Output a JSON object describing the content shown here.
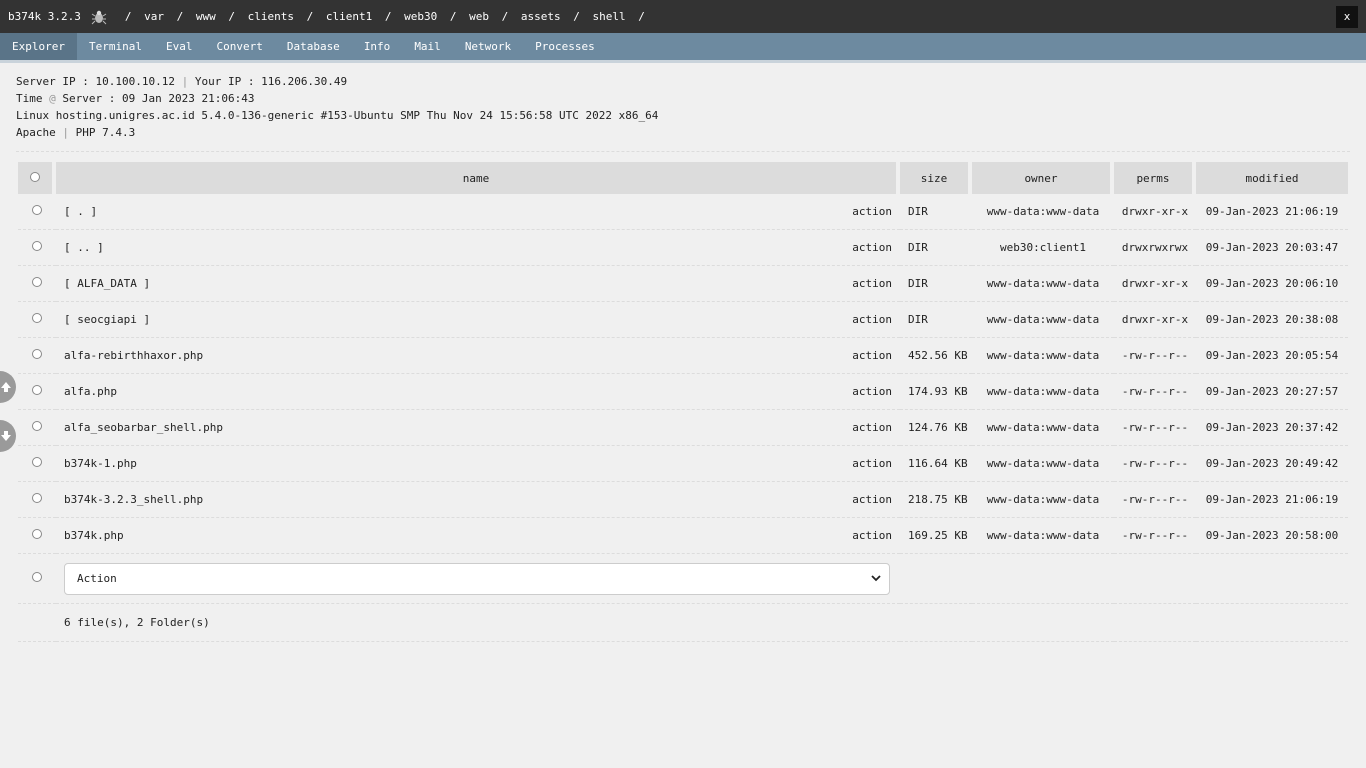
{
  "app": {
    "name": "b374k 3.2.3",
    "bug_icon": "bug-icon",
    "path": [
      "var",
      "www",
      "clients",
      "client1",
      "web30",
      "web",
      "assets",
      "shell"
    ],
    "close_label": "x"
  },
  "menu": [
    {
      "label": "Explorer",
      "active": true
    },
    {
      "label": "Terminal"
    },
    {
      "label": "Eval"
    },
    {
      "label": "Convert"
    },
    {
      "label": "Database"
    },
    {
      "label": "Info"
    },
    {
      "label": "Mail"
    },
    {
      "label": "Network"
    },
    {
      "label": "Processes"
    }
  ],
  "info": {
    "server_ip_label": "Server IP :",
    "server_ip": "10.100.10.12",
    "your_ip_label": "Your IP :",
    "your_ip": "116.206.30.49",
    "time_label": "Time",
    "at": "@",
    "server_label": "Server :",
    "server_time": "09 Jan 2023 21:06:43",
    "uname": "Linux hosting.unigres.ac.id 5.4.0-136-generic #153-Ubuntu SMP Thu Nov 24 15:56:58 UTC 2022 x86_64",
    "software": "Apache",
    "php": "PHP 7.4.3"
  },
  "table": {
    "headers": {
      "name": "name",
      "size": "size",
      "owner": "owner",
      "perms": "perms",
      "modified": "modified"
    },
    "action_link": "action",
    "rows": [
      {
        "name": "[ . ]",
        "size": "DIR",
        "owner": "www-data:www-data",
        "perms": "drwxr-xr-x",
        "modified": "09-Jan-2023 21:06:19"
      },
      {
        "name": "[ .. ]",
        "size": "DIR",
        "owner": "web30:client1",
        "perms": "drwxrwxrwx",
        "modified": "09-Jan-2023 20:03:47"
      },
      {
        "name": "[ ALFA_DATA ]",
        "size": "DIR",
        "owner": "www-data:www-data",
        "perms": "drwxr-xr-x",
        "modified": "09-Jan-2023 20:06:10"
      },
      {
        "name": "[ seocgiapi ]",
        "size": "DIR",
        "owner": "www-data:www-data",
        "perms": "drwxr-xr-x",
        "modified": "09-Jan-2023 20:38:08"
      },
      {
        "name": "alfa-rebirthhaxor.php",
        "size": "452.56 KB",
        "owner": "www-data:www-data",
        "perms": "-rw-r--r--",
        "modified": "09-Jan-2023 20:05:54"
      },
      {
        "name": "alfa.php",
        "size": "174.93 KB",
        "owner": "www-data:www-data",
        "perms": "-rw-r--r--",
        "modified": "09-Jan-2023 20:27:57"
      },
      {
        "name": "alfa_seobarbar_shell.php",
        "size": "124.76 KB",
        "owner": "www-data:www-data",
        "perms": "-rw-r--r--",
        "modified": "09-Jan-2023 20:37:42"
      },
      {
        "name": "b374k-1.php",
        "size": "116.64 KB",
        "owner": "www-data:www-data",
        "perms": "-rw-r--r--",
        "modified": "09-Jan-2023 20:49:42"
      },
      {
        "name": "b374k-3.2.3_shell.php",
        "size": "218.75 KB",
        "owner": "www-data:www-data",
        "perms": "-rw-r--r--",
        "modified": "09-Jan-2023 21:06:19"
      },
      {
        "name": "b374k.php",
        "size": "169.25 KB",
        "owner": "www-data:www-data",
        "perms": "-rw-r--r--",
        "modified": "09-Jan-2023 20:58:00"
      }
    ],
    "action_select": "Action",
    "summary": "6 file(s), 2 Folder(s)"
  },
  "side_buttons": {
    "up_icon": "arrow-up-icon",
    "down_icon": "arrow-down-icon"
  }
}
